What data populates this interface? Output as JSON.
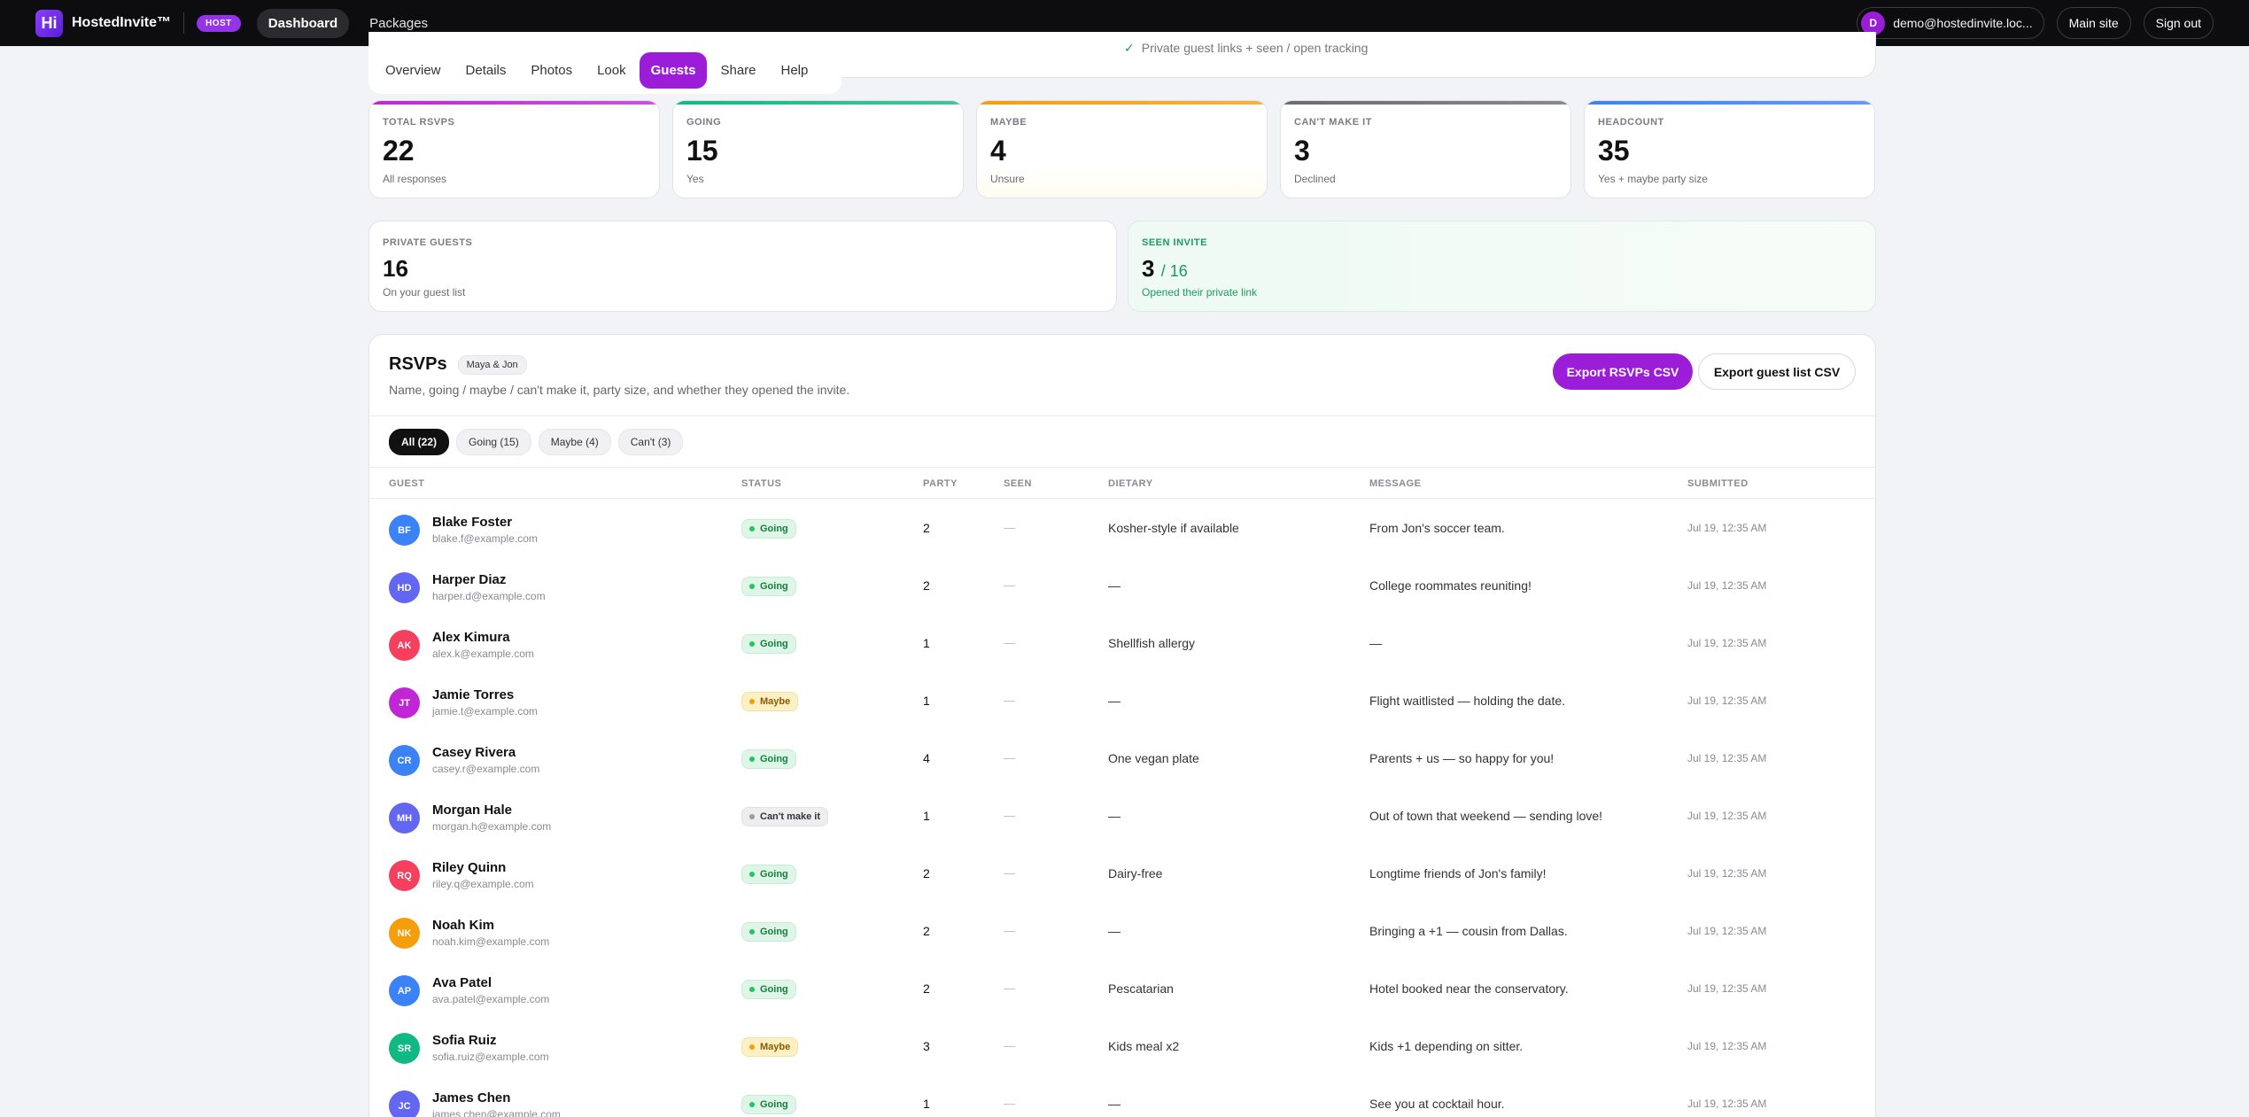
{
  "nav": {
    "logo": "Hi",
    "brand": "HostedInvite™",
    "badge": "HOST",
    "links": [
      "Dashboard",
      "Packages"
    ],
    "user_initial": "D",
    "user_email": "demo@hostedinvite.loc...",
    "main_site": "Main site",
    "sign_out": "Sign out"
  },
  "banner": {
    "check": "✓",
    "text": "Private guest links + seen / open tracking"
  },
  "tabs": [
    "Overview",
    "Details",
    "Photos",
    "Look",
    "Guests",
    "Share",
    "Help"
  ],
  "stats": [
    {
      "label": "Total RSVPs",
      "value": "22",
      "sub": "All responses",
      "color": "#c026d3"
    },
    {
      "label": "Going",
      "value": "15",
      "sub": "Yes",
      "color": "#10b981"
    },
    {
      "label": "Maybe",
      "value": "4",
      "sub": "Unsure",
      "color": "#f59e0b"
    },
    {
      "label": "Can't make it",
      "value": "3",
      "sub": "Declined",
      "color": "#6b6b72"
    },
    {
      "label": "Headcount",
      "value": "35",
      "sub": "Yes + maybe party size",
      "color": "#3b82f6"
    }
  ],
  "private_guests": {
    "label": "Private guests",
    "value": "16",
    "sub": "On your guest list"
  },
  "seen_invite": {
    "label": "Seen invite",
    "value": "3",
    "of": "/ 16",
    "sub": "Opened their private link"
  },
  "rsvps": {
    "title": "RSVPs",
    "event": "Maya & Jon",
    "description": "Name, going / maybe / can't make it, party size, and whether they opened the invite.",
    "export_rsvps": "Export RSVPs CSV",
    "export_guests": "Export guest list CSV",
    "filters": [
      "All (22)",
      "Going (15)",
      "Maybe (4)",
      "Can't (3)"
    ],
    "columns": [
      "GUEST",
      "STATUS",
      "PARTY",
      "SEEN",
      "DIETARY",
      "MESSAGE",
      "SUBMITTED"
    ],
    "rows": [
      {
        "initials": "BF",
        "name": "Blake Foster",
        "email": "blake.f@example.com",
        "status": "Going",
        "party": "2",
        "seen": "—",
        "dietary": "Kosher-style if available",
        "message": "From Jon's soccer team.",
        "submitted": "Jul 19, 12:35 AM",
        "color": "#3b82f6"
      },
      {
        "initials": "HD",
        "name": "Harper Diaz",
        "email": "harper.d@example.com",
        "status": "Going",
        "party": "2",
        "seen": "—",
        "dietary": "—",
        "message": "College roommates reuniting!",
        "submitted": "Jul 19, 12:35 AM",
        "color": "#6366f1"
      },
      {
        "initials": "AK",
        "name": "Alex Kimura",
        "email": "alex.k@example.com",
        "status": "Going",
        "party": "1",
        "seen": "—",
        "dietary": "Shellfish allergy",
        "message": "—",
        "submitted": "Jul 19, 12:35 AM",
        "color": "#f43f5e"
      },
      {
        "initials": "JT",
        "name": "Jamie Torres",
        "email": "jamie.t@example.com",
        "status": "Maybe",
        "party": "1",
        "seen": "—",
        "dietary": "—",
        "message": "Flight waitlisted — holding the date.",
        "submitted": "Jul 19, 12:35 AM",
        "color": "#c026d3"
      },
      {
        "initials": "CR",
        "name": "Casey Rivera",
        "email": "casey.r@example.com",
        "status": "Going",
        "party": "4",
        "seen": "—",
        "dietary": "One vegan plate",
        "message": "Parents + us — so happy for you!",
        "submitted": "Jul 19, 12:35 AM",
        "color": "#3b82f6"
      },
      {
        "initials": "MH",
        "name": "Morgan Hale",
        "email": "morgan.h@example.com",
        "status": "Can't make it",
        "party": "1",
        "seen": "—",
        "dietary": "—",
        "message": "Out of town that weekend — sending love!",
        "submitted": "Jul 19, 12:35 AM",
        "color": "#6366f1"
      },
      {
        "initials": "RQ",
        "name": "Riley Quinn",
        "email": "riley.q@example.com",
        "status": "Going",
        "party": "2",
        "seen": "—",
        "dietary": "Dairy-free",
        "message": "Longtime friends of Jon's family!",
        "submitted": "Jul 19, 12:35 AM",
        "color": "#f43f5e"
      },
      {
        "initials": "NK",
        "name": "Noah Kim",
        "email": "noah.kim@example.com",
        "status": "Going",
        "party": "2",
        "seen": "—",
        "dietary": "—",
        "message": "Bringing a +1 — cousin from Dallas.",
        "submitted": "Jul 19, 12:35 AM",
        "color": "#f59e0b"
      },
      {
        "initials": "AP",
        "name": "Ava Patel",
        "email": "ava.patel@example.com",
        "status": "Going",
        "party": "2",
        "seen": "—",
        "dietary": "Pescatarian",
        "message": "Hotel booked near the conservatory.",
        "submitted": "Jul 19, 12:35 AM",
        "color": "#3b82f6"
      },
      {
        "initials": "SR",
        "name": "Sofia Ruiz",
        "email": "sofia.ruiz@example.com",
        "status": "Maybe",
        "party": "3",
        "seen": "—",
        "dietary": "Kids meal x2",
        "message": "Kids +1 depending on sitter.",
        "submitted": "Jul 19, 12:35 AM",
        "color": "#10b981"
      },
      {
        "initials": "JC",
        "name": "James Chen",
        "email": "james.chen@example.com",
        "status": "Going",
        "party": "1",
        "seen": "—",
        "dietary": "—",
        "message": "See you at cocktail hour.",
        "submitted": "Jul 19, 12:35 AM",
        "color": "#6366f1"
      }
    ]
  }
}
